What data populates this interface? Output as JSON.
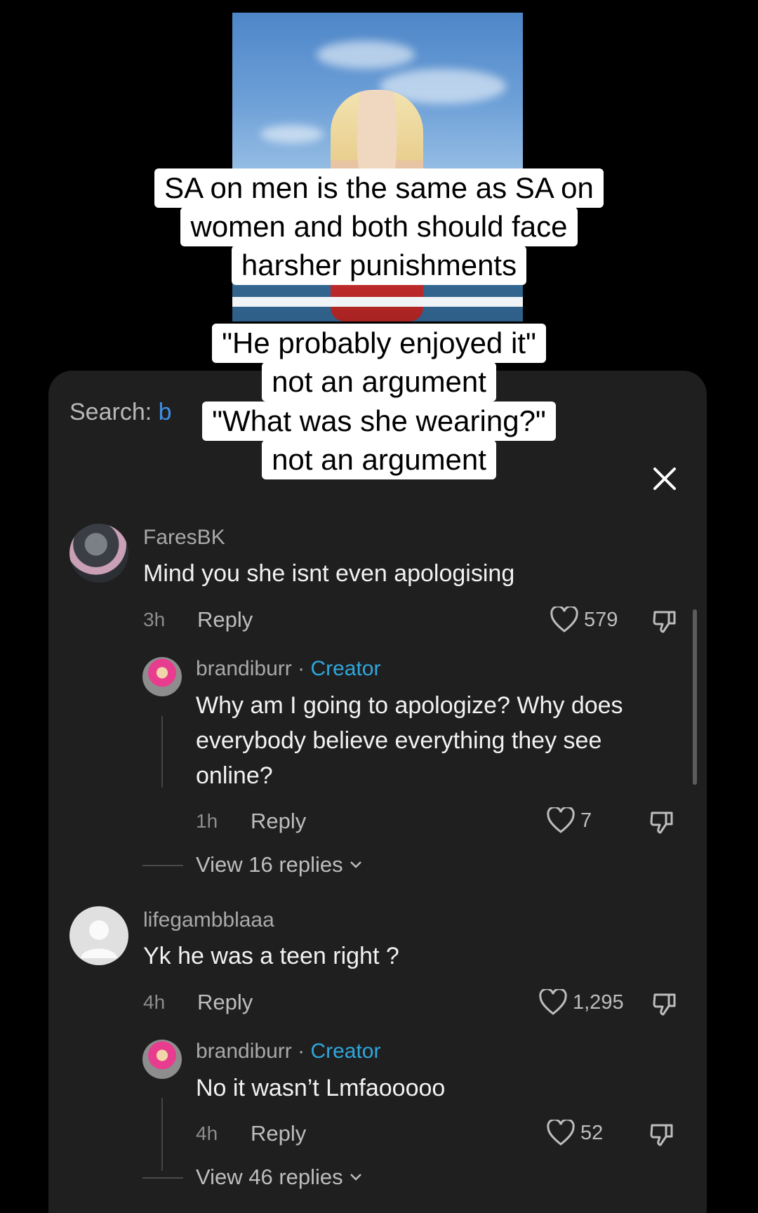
{
  "captions": {
    "line1": "SA on men is the same as SA on",
    "line2": "women and both should face",
    "line3": "harsher punishments",
    "line4": "\"He probably enjoyed  it\"",
    "line5": "not an argument",
    "line6": "\"What was she wearing?\"",
    "line7": "not an argument"
  },
  "search": {
    "label": "Search:",
    "hint": "b"
  },
  "comments": [
    {
      "username": "FaresBK",
      "text": "Mind you she isnt even apologising",
      "time": "3h",
      "reply_label": "Reply",
      "likes": "579",
      "replies": [
        {
          "username": "brandiburr",
          "separator": "·",
          "badge": "Creator",
          "text": "Why am I going to apologize? Why does everybody believe everything they see online?",
          "time": "1h",
          "reply_label": "Reply",
          "likes": "7"
        }
      ],
      "view_replies": "View 16 replies"
    },
    {
      "username": "lifegambblaaa",
      "text": "Yk he was a teen right ?",
      "time": "4h",
      "reply_label": "Reply",
      "likes": "1,295",
      "replies": [
        {
          "username": "brandiburr",
          "separator": "·",
          "badge": "Creator",
          "text": "No it wasn’t Lmfaooooo",
          "time": "4h",
          "reply_label": "Reply",
          "likes": "52"
        }
      ],
      "view_replies": "View 46 replies"
    }
  ],
  "colors": {
    "sheet": "#1f1f1f",
    "creator": "#2fa7dc",
    "search_hint": "#3d8fe6"
  }
}
